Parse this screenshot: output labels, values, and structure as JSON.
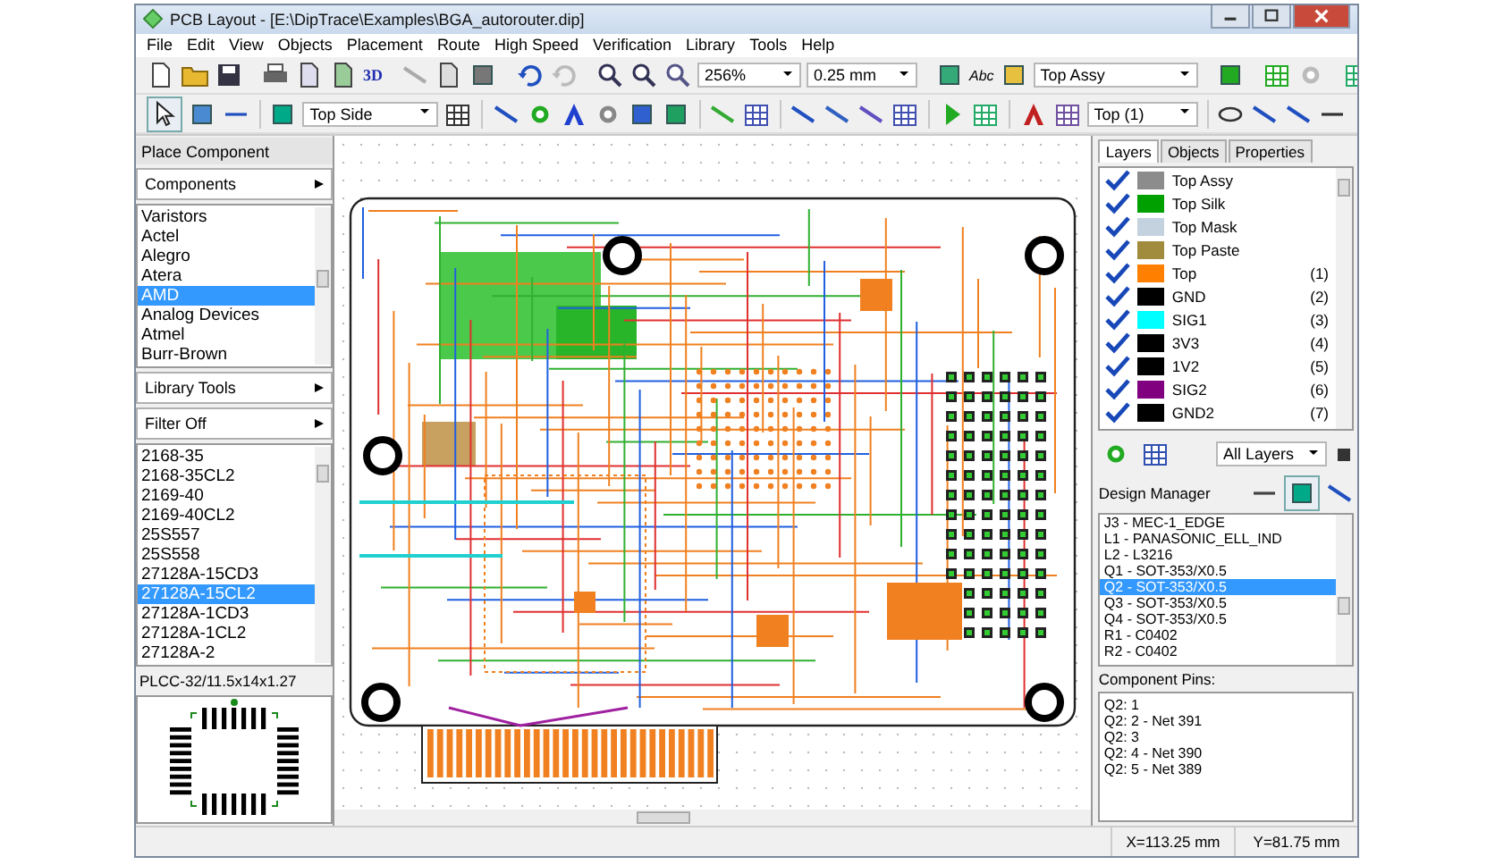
{
  "window": {
    "title": "PCB Layout - [E:\\DipTrace\\Examples\\BGA_autorouter.dip]"
  },
  "menu": [
    "File",
    "Edit",
    "View",
    "Objects",
    "Placement",
    "Route",
    "High Speed",
    "Verification",
    "Library",
    "Tools",
    "Help"
  ],
  "toolbar_1": {
    "view_3d": "3D",
    "zoom": "256%",
    "grid_size": "0.25 mm",
    "text_tool": "Abc",
    "display_layer": "Top Assy"
  },
  "toolbar_2": {
    "side": "Top Side",
    "route_layer": "Top (1)"
  },
  "place_component": {
    "header": "Place Component",
    "group_dropdown": "Components",
    "libraries": [
      {
        "label": "Varistors",
        "selected": false
      },
      {
        "label": "Actel",
        "selected": false
      },
      {
        "label": "Alegro",
        "selected": false
      },
      {
        "label": "Atera",
        "selected": false
      },
      {
        "label": "AMD",
        "selected": true
      },
      {
        "label": "Analog Devices",
        "selected": false
      },
      {
        "label": "Atmel",
        "selected": false
      },
      {
        "label": "Burr-Brown",
        "selected": false
      }
    ],
    "library_tools": "Library Tools",
    "filter": "Filter Off",
    "parts": [
      {
        "label": "2168-35",
        "selected": false
      },
      {
        "label": "2168-35CL2",
        "selected": false
      },
      {
        "label": "2169-40",
        "selected": false
      },
      {
        "label": "2169-40CL2",
        "selected": false
      },
      {
        "label": "25S557",
        "selected": false
      },
      {
        "label": "25S558",
        "selected": false
      },
      {
        "label": "27128A-15CD3",
        "selected": false
      },
      {
        "label": "27128A-15CL2",
        "selected": true
      },
      {
        "label": "27128A-1CD3",
        "selected": false
      },
      {
        "label": "27128A-1CL2",
        "selected": false
      },
      {
        "label": "27128A-2",
        "selected": false
      }
    ],
    "pattern": "PLCC-32/11.5x14x1.27"
  },
  "layers_panel": {
    "tabs": [
      {
        "label": "Layers",
        "selected": true
      },
      {
        "label": "Objects",
        "selected": false
      },
      {
        "label": "Properties",
        "selected": false
      }
    ],
    "layers": [
      {
        "name": "Top Assy",
        "visible": true,
        "color": "#8c8c8c"
      },
      {
        "name": "Top Silk",
        "visible": true,
        "color": "#00a000"
      },
      {
        "name": "Top Mask",
        "visible": true,
        "color": "#c4d2e0"
      },
      {
        "name": "Top Paste",
        "visible": true,
        "color": "#a08c3c"
      },
      {
        "name": "Top",
        "number": "(1)",
        "visible": true,
        "color": "#ff8000"
      },
      {
        "name": "GND",
        "number": "(2)",
        "visible": true,
        "color": "#000000"
      },
      {
        "name": "SIG1",
        "number": "(3)",
        "visible": true,
        "color": "#00ffff"
      },
      {
        "name": "3V3",
        "number": "(4)",
        "visible": true,
        "color": "#000000"
      },
      {
        "name": "1V2",
        "number": "(5)",
        "visible": true,
        "color": "#000000"
      },
      {
        "name": "SIG2",
        "number": "(6)",
        "visible": true,
        "color": "#800080"
      },
      {
        "name": "GND2",
        "number": "(7)",
        "visible": true,
        "color": "#000000"
      }
    ],
    "filter": "All Layers"
  },
  "design_manager": {
    "title": "Design Manager",
    "components": [
      {
        "label": "J3 - MEC-1_EDGE",
        "selected": false
      },
      {
        "label": "L1 - PANASONIC_ELL_IND",
        "selected": false
      },
      {
        "label": "L2 - L3216",
        "selected": false
      },
      {
        "label": "Q1 - SOT-353/X0.5",
        "selected": false
      },
      {
        "label": "Q2 - SOT-353/X0.5",
        "selected": true
      },
      {
        "label": "Q3 - SOT-353/X0.5",
        "selected": false
      },
      {
        "label": "Q4 - SOT-353/X0.5",
        "selected": false
      },
      {
        "label": "R1 - C0402",
        "selected": false
      },
      {
        "label": "R2 - C0402",
        "selected": false
      }
    ],
    "pins_label": "Component Pins:",
    "pins": [
      "Q2: 1",
      "Q2: 2 - Net 391",
      "Q2: 3",
      "Q2: 4 - Net 390",
      "Q2: 5 - Net 389"
    ]
  },
  "status_bar": {
    "x": "X=113.25 mm",
    "y": "Y=81.75 mm"
  }
}
